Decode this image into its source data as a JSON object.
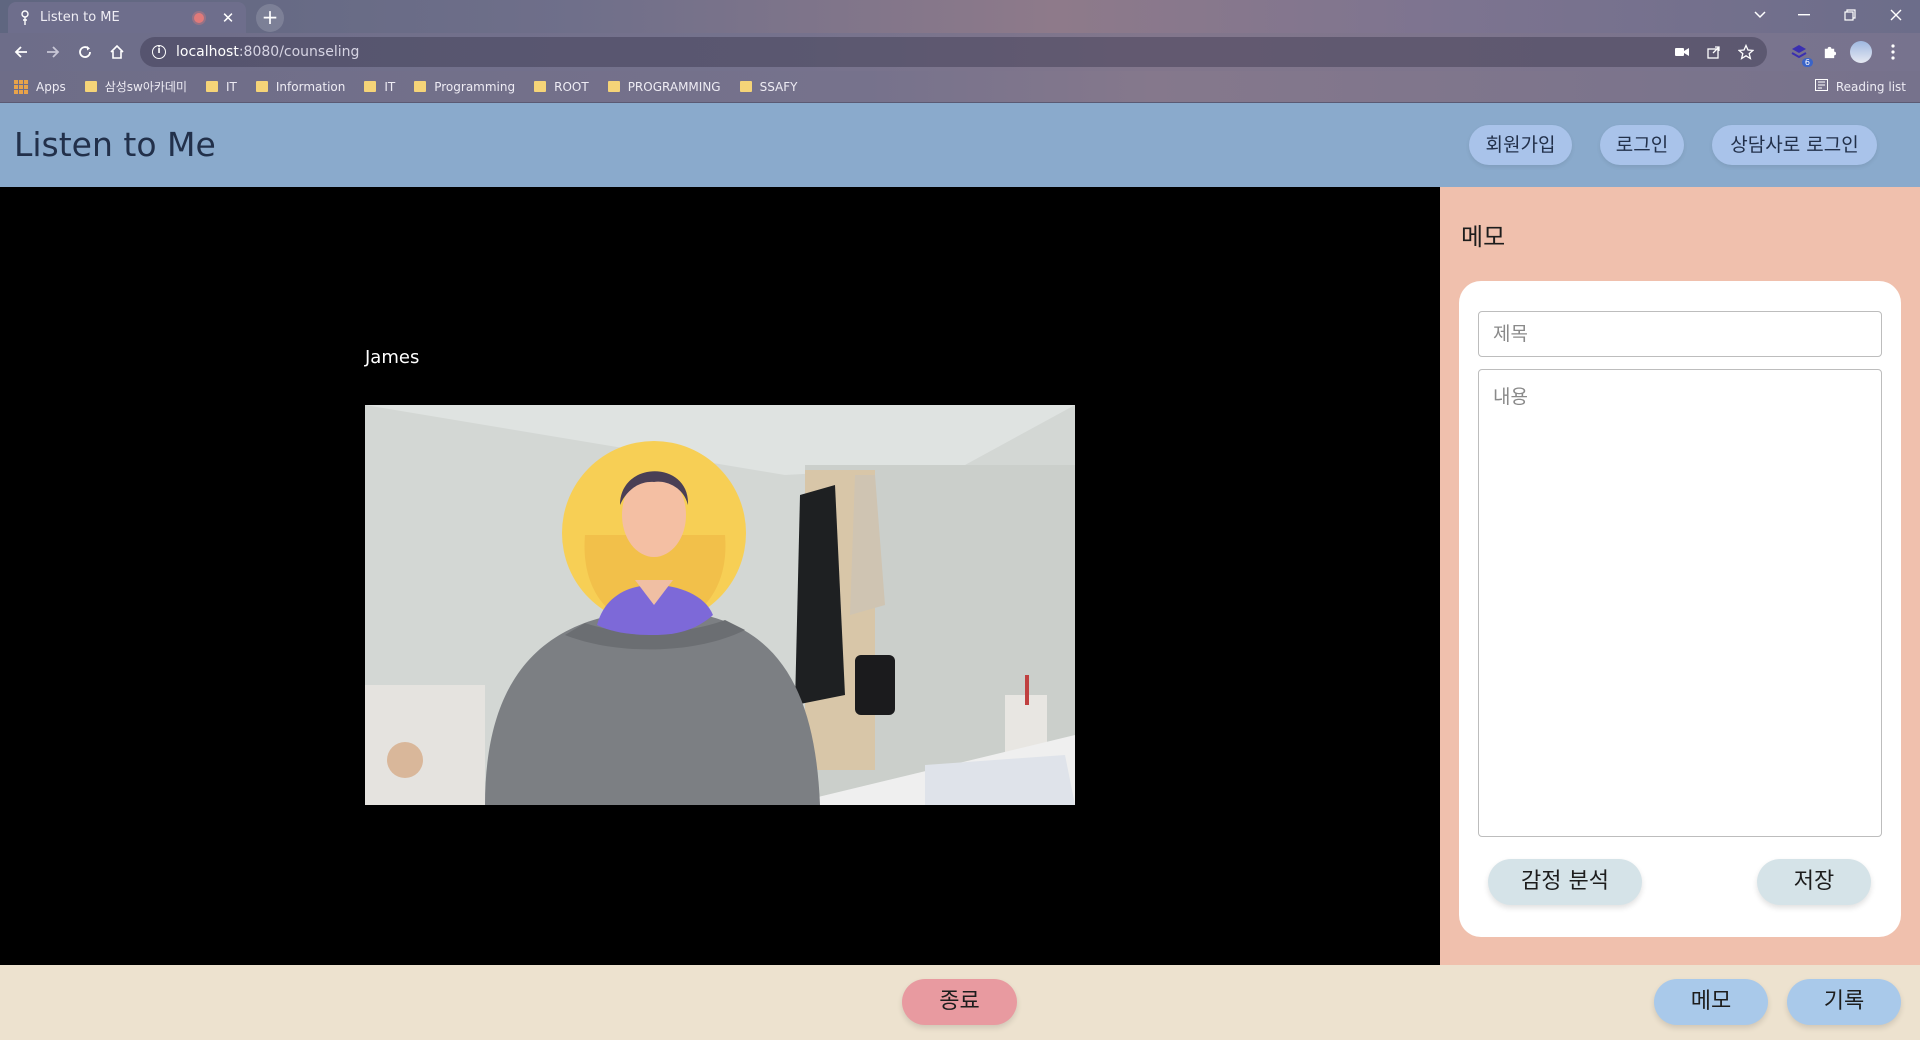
{
  "browser": {
    "tab": {
      "title": "Listen to ME"
    },
    "address": {
      "host": "localhost",
      "path": ":8080/counseling"
    },
    "bookmarks": [
      {
        "label": "Apps",
        "kind": "apps"
      },
      {
        "label": "삼성sw아카데미",
        "kind": "folder"
      },
      {
        "label": "IT",
        "kind": "folder"
      },
      {
        "label": "Information",
        "kind": "folder"
      },
      {
        "label": "IT",
        "kind": "folder"
      },
      {
        "label": "Programming",
        "kind": "folder"
      },
      {
        "label": "ROOT",
        "kind": "folder"
      },
      {
        "label": "PROGRAMMING",
        "kind": "folder"
      },
      {
        "label": "SSAFY",
        "kind": "folder"
      }
    ],
    "reading_list": "Reading list",
    "extension_badge": "6"
  },
  "header": {
    "brand": "Listen to Me",
    "nav": {
      "signup": "회원가입",
      "login": "로그인",
      "counselor_login": "상담사로 로그인"
    },
    "color": "#8aaacc"
  },
  "video": {
    "participant_name": "James"
  },
  "memo": {
    "title": "메모",
    "title_placeholder": "제목",
    "content_placeholder": "내용",
    "emotion_button": "감정 분석",
    "save_button": "저장",
    "panel_color": "#f0c0ad"
  },
  "bottom": {
    "end_button": "종료",
    "memo_button": "메모",
    "record_button": "기록",
    "bar_color": "#ede2cf"
  }
}
